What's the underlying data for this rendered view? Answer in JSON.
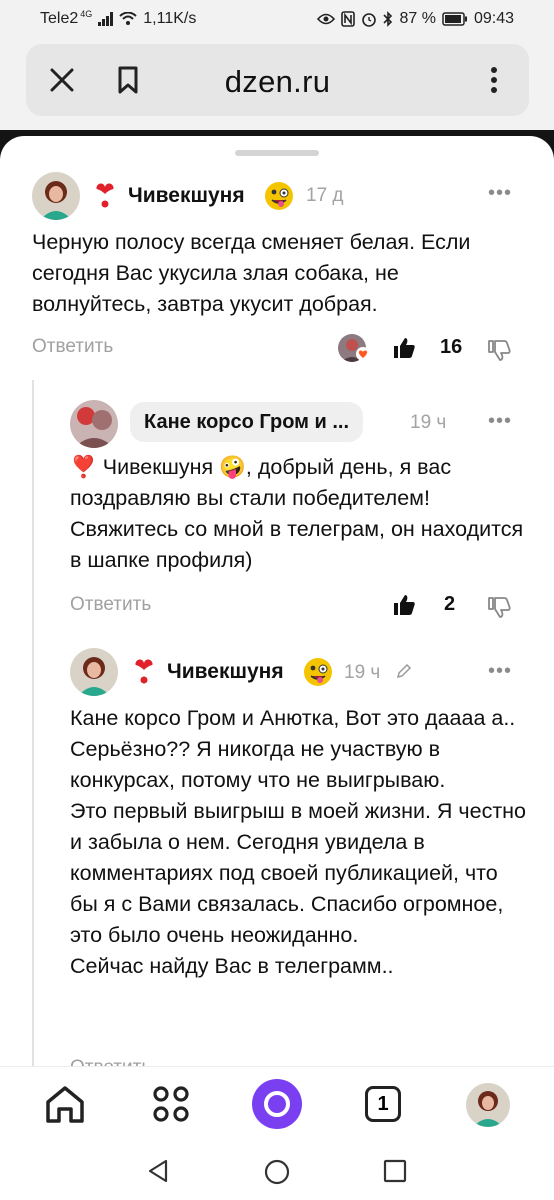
{
  "status_bar": {
    "carrier": "Tele2",
    "network": "4G",
    "speed": "1,11K/s",
    "battery": "87 %",
    "time": "09:43"
  },
  "browser": {
    "url": "dzen.ru",
    "icons": [
      "close-icon",
      "bookmark-icon",
      "more-vertical-icon"
    ]
  },
  "comments": [
    {
      "author": "Чивекшуня",
      "time": "17 д",
      "text": "Черную полосу всегда сменяет белая. Если сегодня Вас укусила злая собака, не волнуйтесь, завтра укусит добрая.",
      "reply_label": "Ответить",
      "likes": "16"
    },
    {
      "author": "Кане корсо Гром и ...",
      "time": "19 ч",
      "text_mention": "❣️ Чивекшуня 🤪",
      "text": ", добрый день, я вас поздравляю вы стали победителем! Свяжитесь со мной в телеграм, он находится в шапке профиля)",
      "reply_label": "Ответить",
      "likes": "2"
    },
    {
      "author": "Чивекшуня",
      "time": "19 ч",
      "text": "Кане корсо Гром и Анютка, Вот это даааа а.. Серьёзно?? Я никогда не участвую в конкурсах, потому что не выигрываю.\nЭто первый выигрыш в моей жизни. Я честно и забыла о нем. Сегодня увидела в комментариях под своей публикацией, что бы я с Вами связалась. Спасибо огромное, это было очень неожиданно.\nСейчас найду Вас в телеграмм..",
      "reply_label": "Ответить"
    }
  ],
  "bottom_nav": {
    "tabs_count": "1",
    "items": [
      "home-icon",
      "apps-grid-icon",
      "alice-icon",
      "tabs-icon",
      "profile-avatar"
    ]
  },
  "colors": {
    "accent_alice": "#7b3ff2",
    "like_heart": "#ff5a1f",
    "emoji_yellow": "#f5c400"
  }
}
